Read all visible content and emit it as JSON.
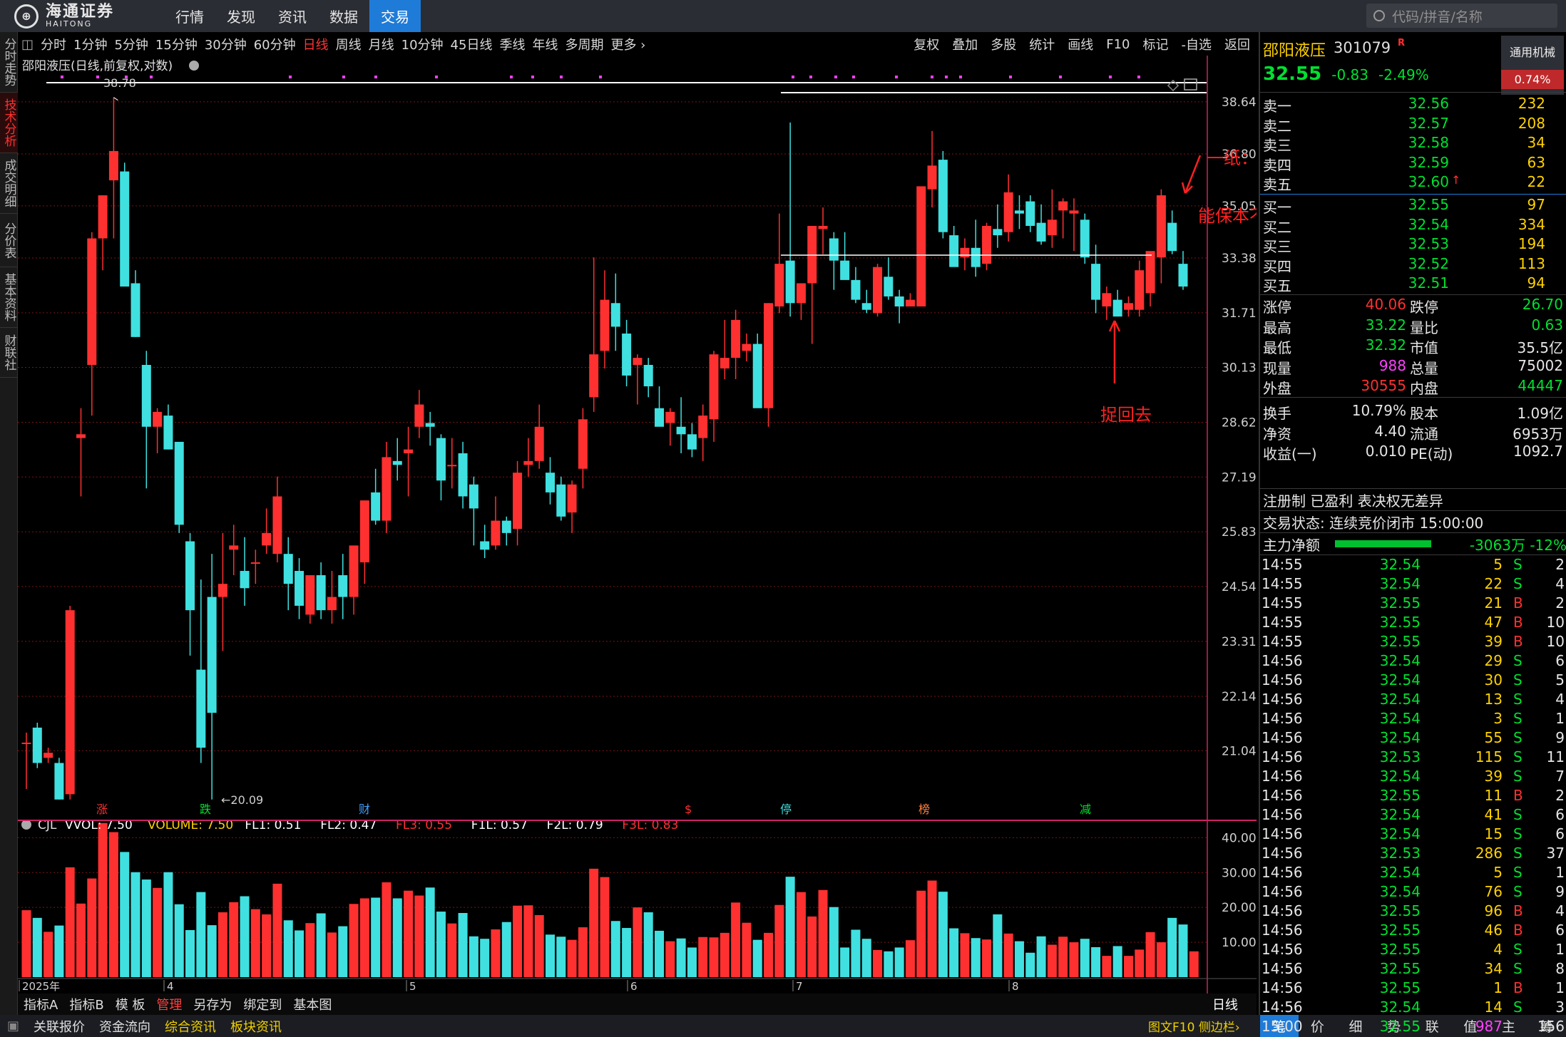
{
  "app": {
    "logo_cn": "海通证券",
    "logo_en": "HAITONG",
    "nav": [
      "行情",
      "发现",
      "资讯",
      "数据",
      "交易"
    ],
    "nav_active": 4,
    "search_placeholder": "代码/拼音/名称"
  },
  "left_tabs": [
    "分时走势",
    "技术分析",
    "成交明细",
    "分价表",
    "基本资料",
    "财联社"
  ],
  "left_tab_active": 1,
  "periods": [
    "分时",
    "1分钟",
    "5分钟",
    "15分钟",
    "30分钟",
    "60分钟",
    "日线",
    "周线",
    "月线",
    "10分钟",
    "45日线",
    "季线",
    "年线",
    "多周期",
    "更多 ›"
  ],
  "period_active": 6,
  "toolbar_right": [
    "复权",
    "叠加",
    "多股",
    "统计",
    "画线",
    "F10",
    "标记",
    "-自选",
    "返回"
  ],
  "chart_title": "邵阳液压(日线,前复权,对数)",
  "chart_data": [
    {
      "type": "candlestick",
      "title": "邵阳液压(日线,前复权,对数)",
      "price_axis_labels": [
        "38.64",
        "36.80",
        "35.05",
        "33.38",
        "31.71",
        "30.13",
        "28.62",
        "27.19",
        "25.83",
        "24.54",
        "23.31",
        "22.14",
        "21.04"
      ],
      "high_label": "38.78",
      "low_label": "←20.09",
      "month_labels": [
        "2025年",
        "4",
        "5",
        "6",
        "7",
        "8"
      ],
      "event_labels": [
        "涨",
        "跌",
        "财",
        "$",
        "停",
        "榜",
        "减"
      ],
      "candles": [
        [
          21.2,
          21.4,
          20.3,
          21.2
        ],
        [
          21.5,
          21.6,
          20.7,
          20.8
        ],
        [
          20.9,
          21.1,
          20.8,
          21.0
        ],
        [
          20.8,
          20.9,
          20.1,
          20.1
        ],
        [
          20.2,
          24.1,
          20.1,
          24.0
        ],
        [
          28.2,
          29.0,
          26.7,
          28.3
        ],
        [
          30.2,
          34.2,
          28.8,
          34.0
        ],
        [
          34.0,
          35.4,
          33.0,
          35.4
        ],
        [
          35.9,
          38.8,
          34.0,
          36.9
        ],
        [
          36.2,
          36.5,
          32.5,
          32.5
        ],
        [
          32.6,
          33.0,
          31.0,
          31.0
        ],
        [
          30.2,
          30.6,
          26.9,
          28.5
        ],
        [
          28.5,
          29.0,
          27.8,
          28.9
        ],
        [
          28.8,
          29.1,
          27.9,
          27.9
        ],
        [
          28.1,
          28.1,
          25.8,
          26.0
        ],
        [
          25.6,
          25.8,
          23.0,
          24.0
        ],
        [
          22.7,
          24.7,
          20.8,
          21.1
        ],
        [
          24.3,
          25.3,
          20.1,
          21.8
        ],
        [
          24.3,
          25.8,
          23.1,
          24.6
        ],
        [
          25.4,
          26.0,
          24.8,
          25.5
        ],
        [
          24.9,
          25.7,
          24.1,
          24.5
        ],
        [
          25.1,
          25.4,
          24.6,
          25.1
        ],
        [
          25.5,
          26.4,
          25.3,
          25.8
        ],
        [
          25.3,
          27.2,
          25.1,
          26.7
        ],
        [
          25.3,
          25.7,
          24.0,
          24.6
        ],
        [
          24.9,
          25.2,
          23.8,
          24.1
        ],
        [
          23.9,
          24.7,
          23.7,
          24.8
        ],
        [
          24.8,
          25.1,
          23.8,
          24.0
        ],
        [
          24.0,
          24.9,
          23.7,
          24.3
        ],
        [
          24.8,
          25.3,
          23.8,
          24.3
        ],
        [
          24.3,
          25.4,
          23.9,
          25.5
        ],
        [
          25.1,
          26.4,
          24.6,
          26.6
        ],
        [
          26.8,
          27.4,
          26.0,
          26.1
        ],
        [
          26.1,
          28.1,
          25.8,
          27.7
        ],
        [
          27.6,
          28.2,
          27.1,
          27.5
        ],
        [
          27.8,
          28.5,
          26.7,
          27.9
        ],
        [
          28.5,
          29.5,
          28.2,
          29.1
        ],
        [
          28.6,
          28.9,
          28.0,
          28.5
        ],
        [
          28.2,
          28.3,
          26.6,
          27.1
        ],
        [
          27.5,
          28.2,
          26.9,
          27.5
        ],
        [
          27.8,
          28.1,
          26.4,
          26.7
        ],
        [
          27.0,
          27.2,
          25.5,
          26.4
        ],
        [
          25.6,
          26.0,
          25.2,
          25.4
        ],
        [
          25.5,
          26.7,
          25.4,
          26.1
        ],
        [
          26.1,
          26.2,
          25.5,
          25.8
        ],
        [
          25.9,
          27.6,
          25.5,
          27.3
        ],
        [
          27.5,
          28.2,
          27.2,
          27.6
        ],
        [
          27.6,
          29.1,
          27.4,
          28.5
        ],
        [
          27.3,
          27.7,
          26.5,
          26.8
        ],
        [
          27.0,
          27.2,
          26.1,
          26.2
        ],
        [
          26.3,
          27.1,
          25.8,
          27.0
        ],
        [
          27.4,
          29.0,
          26.9,
          28.7
        ],
        [
          29.3,
          33.4,
          28.9,
          30.5
        ],
        [
          30.6,
          33.0,
          30.1,
          32.1
        ],
        [
          32.0,
          32.9,
          30.6,
          31.3
        ],
        [
          31.1,
          31.5,
          29.6,
          29.9
        ],
        [
          30.2,
          30.5,
          29.1,
          30.4
        ],
        [
          30.2,
          30.4,
          29.3,
          29.6
        ],
        [
          29.0,
          29.6,
          28.8,
          28.5
        ],
        [
          28.6,
          29.0,
          28.0,
          28.9
        ],
        [
          28.5,
          29.3,
          27.8,
          28.3
        ],
        [
          28.3,
          28.6,
          27.7,
          27.9
        ],
        [
          28.2,
          29.1,
          27.6,
          28.8
        ],
        [
          28.7,
          30.6,
          28.1,
          30.5
        ],
        [
          30.1,
          31.5,
          29.8,
          30.4
        ],
        [
          30.4,
          31.8,
          29.8,
          31.5
        ],
        [
          30.6,
          31.1,
          30.3,
          30.8
        ],
        [
          30.8,
          31.1,
          29.2,
          29.0
        ],
        [
          29.0,
          32.0,
          28.5,
          32.0
        ],
        [
          31.9,
          34.8,
          31.7,
          33.2
        ],
        [
          33.3,
          37.9,
          31.6,
          32.0
        ],
        [
          32.0,
          32.5,
          31.5,
          32.6
        ],
        [
          32.6,
          34.4,
          30.8,
          34.4
        ],
        [
          34.3,
          35.0,
          33.5,
          34.4
        ],
        [
          34.0,
          34.2,
          32.4,
          33.3
        ],
        [
          33.3,
          34.2,
          32.8,
          32.7
        ],
        [
          32.7,
          33.1,
          32.0,
          32.1
        ],
        [
          32.0,
          32.4,
          31.7,
          31.8
        ],
        [
          31.7,
          33.2,
          31.6,
          33.1
        ],
        [
          32.8,
          33.4,
          32.1,
          32.2
        ],
        [
          32.2,
          32.4,
          31.4,
          31.9
        ],
        [
          31.9,
          32.3,
          31.9,
          32.1
        ],
        [
          31.9,
          35.0,
          31.9,
          35.7
        ],
        [
          35.6,
          37.6,
          35.0,
          36.4
        ],
        [
          36.6,
          36.9,
          34.0,
          34.2
        ],
        [
          34.1,
          34.4,
          33.2,
          33.1
        ],
        [
          33.4,
          34.0,
          33.0,
          33.7
        ],
        [
          33.7,
          34.6,
          32.8,
          33.1
        ],
        [
          33.2,
          34.5,
          33.0,
          34.4
        ],
        [
          34.3,
          35.1,
          33.7,
          34.1
        ],
        [
          34.2,
          36.1,
          33.9,
          35.5
        ],
        [
          34.9,
          35.4,
          34.3,
          34.8
        ],
        [
          35.2,
          35.4,
          34.2,
          34.4
        ],
        [
          34.5,
          35.1,
          33.8,
          33.9
        ],
        [
          34.1,
          35.6,
          33.7,
          34.6
        ],
        [
          34.9,
          35.3,
          34.0,
          35.2
        ],
        [
          34.8,
          35.3,
          33.6,
          34.9
        ],
        [
          34.6,
          34.8,
          33.2,
          33.4
        ],
        [
          33.2,
          33.8,
          31.7,
          32.1
        ],
        [
          31.9,
          32.5,
          31.5,
          32.3
        ],
        [
          32.1,
          32.4,
          31.6,
          31.6
        ],
        [
          31.8,
          32.2,
          31.6,
          32.0
        ],
        [
          31.8,
          33.3,
          31.6,
          33.0
        ],
        [
          32.3,
          33.3,
          31.9,
          33.6
        ],
        [
          33.4,
          35.6,
          32.6,
          35.4
        ],
        [
          34.5,
          34.9,
          33.5,
          33.6
        ],
        [
          33.2,
          33.6,
          32.4,
          32.5
        ]
      ],
      "volume_axis_labels": [
        "40.00",
        "30.00",
        "20.00",
        "10.00"
      ],
      "volume": [
        19.2,
        17.0,
        13.0,
        14.8,
        31.5,
        21.1,
        28.3,
        44.2,
        41.6,
        35.9,
        30.1,
        28.0,
        25.6,
        30.1,
        20.9,
        13.5,
        24.4,
        14.9,
        18.6,
        21.5,
        23.2,
        19.5,
        18.0,
        26.8,
        16.3,
        13.4,
        15.5,
        18.3,
        12.8,
        14.6,
        21.0,
        22.6,
        22.8,
        27.2,
        22.6,
        24.8,
        23.4,
        25.7,
        18.8,
        15.4,
        18.4,
        11.7,
        11.0,
        13.7,
        15.8,
        20.5,
        20.6,
        17.8,
        12.2,
        11.6,
        10.7,
        14.3,
        31.1,
        28.7,
        16.1,
        14.1,
        20.0,
        18.6,
        13.3,
        10.3,
        11.1,
        8.5,
        11.5,
        11.4,
        12.7,
        21.4,
        15.6,
        10.7,
        12.7,
        20.7,
        28.8,
        24.4,
        17.4,
        25.0,
        20.1,
        8.5,
        13.6,
        11.0,
        7.8,
        7.4,
        8.5,
        10.6,
        24.8,
        27.7,
        24.5,
        14.0,
        12.6,
        11.2,
        10.8,
        18.0,
        12.5,
        10.3,
        7.0,
        11.7,
        9.3,
        11.6,
        10.0,
        11.0,
        8.6,
        6.1,
        8.9,
        6.1,
        7.9,
        12.9,
        10.0,
        17.0,
        15.1,
        7.4
      ],
      "volume_indicator": {
        "name": "CJL",
        "items": [
          {
            "label": "VVOL: 7.50",
            "color": "#ffffff"
          },
          {
            "label": "VOLUME: 7.50",
            "color": "#ffd200"
          },
          {
            "label": "FL1: 0.51",
            "color": "#ffffff"
          },
          {
            "label": "FL2: 0.47",
            "color": "#ffffff"
          },
          {
            "label": "FL3: 0.55",
            "color": "#ff3030"
          },
          {
            "label": "F1L: 0.57",
            "color": "#ffffff"
          },
          {
            "label": "F2L: 0.79",
            "color": "#ffffff"
          },
          {
            "label": "F3L: 0.83",
            "color": "#ff3030"
          }
        ]
      },
      "annotations": [
        "一纸：减持",
        "能保本不？",
        "捉回去"
      ],
      "colors": {
        "up": "#ff3030",
        "down": "#40e0e0",
        "grid": "#7a1414"
      }
    }
  ],
  "sub_tabs": [
    "指标A",
    "指标B",
    "模 板",
    "管理",
    "另存为",
    "绑定到",
    "基本图"
  ],
  "sub_tab_red": 3,
  "period_side_label": "日线",
  "bottom_left": [
    "关联报价",
    "资金流向",
    "综合资讯",
    "板块资讯"
  ],
  "bottom_right_label": "图文F10 侧边栏›",
  "right_tabs": [
    "笔",
    "价",
    "细",
    "势",
    "联",
    "值",
    "主",
    "筹"
  ],
  "quote": {
    "name": "邵阳液压",
    "code": "301079",
    "tag": "R",
    "industry": "通用机械",
    "industry_pct": "0.74%",
    "price": "32.55",
    "change": "-0.83",
    "change_pct": "-2.49%",
    "asks": [
      {
        "label": "卖五",
        "price": "32.60",
        "vol": "22"
      },
      {
        "label": "卖四",
        "price": "32.59",
        "vol": "63"
      },
      {
        "label": "卖三",
        "price": "32.58",
        "vol": "34"
      },
      {
        "label": "卖二",
        "price": "32.57",
        "vol": "208"
      },
      {
        "label": "卖一",
        "price": "32.56",
        "vol": "232"
      }
    ],
    "bids": [
      {
        "label": "买一",
        "price": "32.55",
        "vol": "97"
      },
      {
        "label": "买二",
        "price": "32.54",
        "vol": "334"
      },
      {
        "label": "买三",
        "price": "32.53",
        "vol": "194"
      },
      {
        "label": "买四",
        "price": "32.52",
        "vol": "113"
      },
      {
        "label": "买五",
        "price": "32.51",
        "vol": "94"
      }
    ],
    "stats": [
      {
        "l1": "涨停",
        "v1": "40.06",
        "c1": "red",
        "l2": "跌停",
        "v2": "26.70",
        "c2": "green"
      },
      {
        "l1": "最高",
        "v1": "33.22",
        "c1": "green",
        "l2": "量比",
        "v2": "0.63",
        "c2": "green"
      },
      {
        "l1": "最低",
        "v1": "32.32",
        "c1": "green",
        "l2": "市值",
        "v2": "35.5亿",
        "c2": "white"
      },
      {
        "l1": "现量",
        "v1": "988",
        "c1": "magenta",
        "l2": "总量",
        "v2": "75002",
        "c2": "white"
      },
      {
        "l1": "外盘",
        "v1": "30555",
        "c1": "red",
        "l2": "内盘",
        "v2": "44447",
        "c2": "green"
      },
      {
        "l1": "换手",
        "v1": "10.79%",
        "c1": "white",
        "l2": "股本",
        "v2": "1.09亿",
        "c2": "white"
      },
      {
        "l1": "净资",
        "v1": "4.40",
        "c1": "white",
        "l2": "流通",
        "v2": "6953万",
        "c2": "white"
      },
      {
        "l1": "收益(一)",
        "v1": "0.010",
        "c1": "white",
        "l2": "PE(动)",
        "v2": "1092.7",
        "c2": "white"
      }
    ],
    "reg_text": "注册制 已盈利 表决权无差异",
    "trade_status": "交易状态: 连续竞价闭市 15:00:00",
    "flow_label": "主力净额",
    "flow_value": "-3063万 -12%"
  },
  "ticks": [
    [
      "14:55",
      "32.54",
      "5",
      "S",
      "2"
    ],
    [
      "14:55",
      "32.54",
      "22",
      "S",
      "4"
    ],
    [
      "14:55",
      "32.55",
      "21",
      "B",
      "2"
    ],
    [
      "14:55",
      "32.55",
      "47",
      "B",
      "10"
    ],
    [
      "14:55",
      "32.55",
      "39",
      "B",
      "10"
    ],
    [
      "14:56",
      "32.54",
      "29",
      "S",
      "6"
    ],
    [
      "14:56",
      "32.54",
      "30",
      "S",
      "5"
    ],
    [
      "14:56",
      "32.54",
      "13",
      "S",
      "4"
    ],
    [
      "14:56",
      "32.54",
      "3",
      "S",
      "1"
    ],
    [
      "14:56",
      "32.54",
      "55",
      "S",
      "9"
    ],
    [
      "14:56",
      "32.53",
      "115",
      "S",
      "11"
    ],
    [
      "14:56",
      "32.54",
      "39",
      "S",
      "7"
    ],
    [
      "14:56",
      "32.55",
      "11",
      "B",
      "2"
    ],
    [
      "14:56",
      "32.54",
      "41",
      "S",
      "6"
    ],
    [
      "14:56",
      "32.54",
      "15",
      "S",
      "6"
    ],
    [
      "14:56",
      "32.53",
      "286",
      "S",
      "37"
    ],
    [
      "14:56",
      "32.54",
      "5",
      "S",
      "1"
    ],
    [
      "14:56",
      "32.54",
      "76",
      "S",
      "9"
    ],
    [
      "14:56",
      "32.55",
      "96",
      "B",
      "4"
    ],
    [
      "14:56",
      "32.55",
      "46",
      "B",
      "6"
    ],
    [
      "14:56",
      "32.55",
      "4",
      "S",
      "1"
    ],
    [
      "14:56",
      "32.55",
      "34",
      "S",
      "8"
    ],
    [
      "14:56",
      "32.55",
      "1",
      "B",
      "1"
    ],
    [
      "14:56",
      "32.54",
      "14",
      "S",
      "3"
    ],
    [
      "15:00",
      "32.55",
      "987",
      "",
      "156"
    ]
  ]
}
